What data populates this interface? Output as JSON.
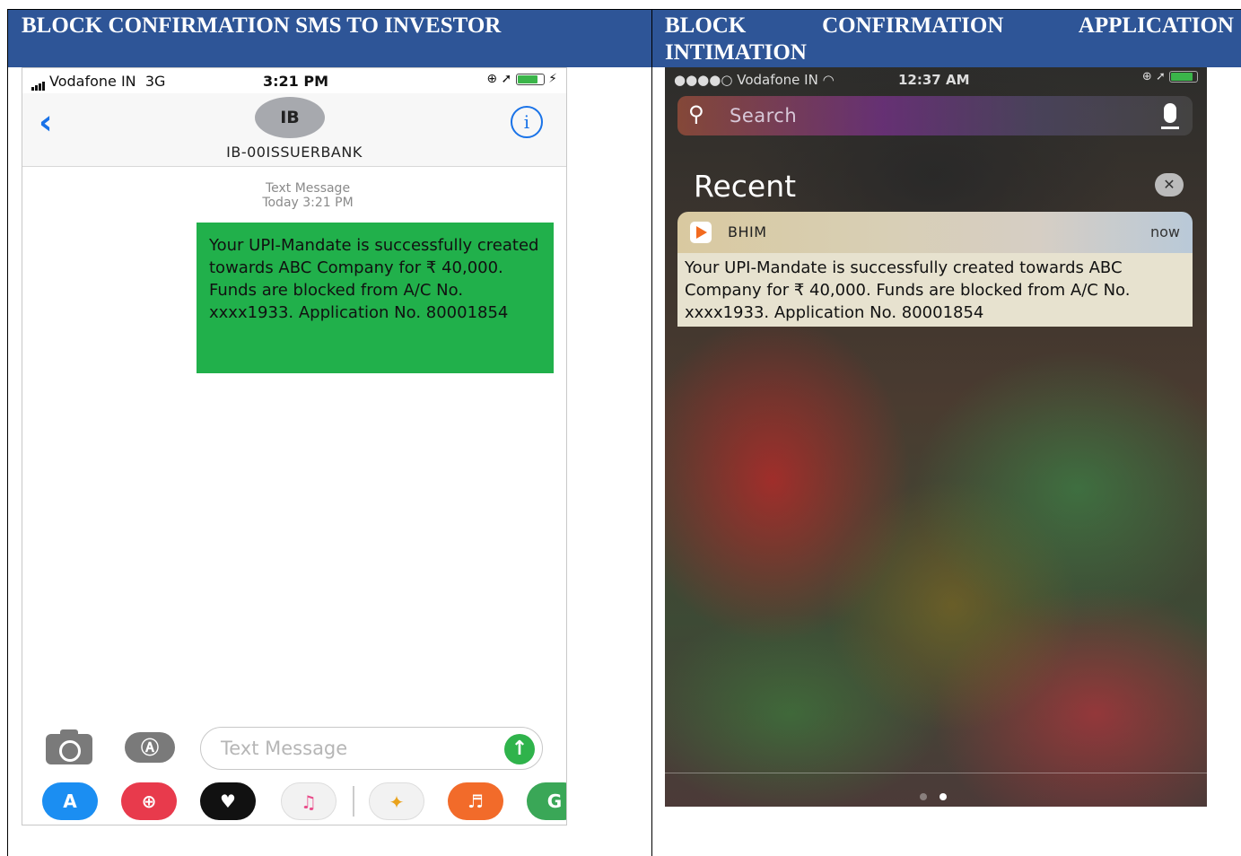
{
  "headers": {
    "left": "BLOCK CONFIRMATION SMS TO INVESTOR",
    "right": "BLOCK CONFIRMATION APPLICATION INTIMATION"
  },
  "sms_screen": {
    "status": {
      "carrier": "Vodafone IN",
      "network": "3G",
      "time": "3:21 PM"
    },
    "nav": {
      "back_icon": "chevron-left-icon",
      "avatar_initials": "IB",
      "contact_name": "IB-00ISSUERBANK",
      "info_icon": "info-icon"
    },
    "meta": {
      "label": "Text Message",
      "timestamp": "Today 3:21 PM"
    },
    "message": "Your UPI-Mandate is successfully created towards ABC Company for ₹ 40,000. Funds are blocked from A/C No. xxxx1933. Application No. 80001854",
    "composer": {
      "placeholder": "Text Message",
      "send_icon": "send-arrow-icon"
    },
    "colors": {
      "bubble": "#21b04b",
      "accent": "#1a73e8"
    }
  },
  "lock_screen": {
    "status": {
      "carrier": "Vodafone IN",
      "time": "12:37 AM"
    },
    "search": {
      "placeholder": "Search"
    },
    "section_title": "Recent",
    "notification": {
      "app": "BHIM",
      "time": "now",
      "body": "Your UPI-Mandate is successfully created towards ABC Company for ₹ 40,000. Funds are blocked from A/C No. xxxx1933. Application No. 80001854"
    }
  }
}
